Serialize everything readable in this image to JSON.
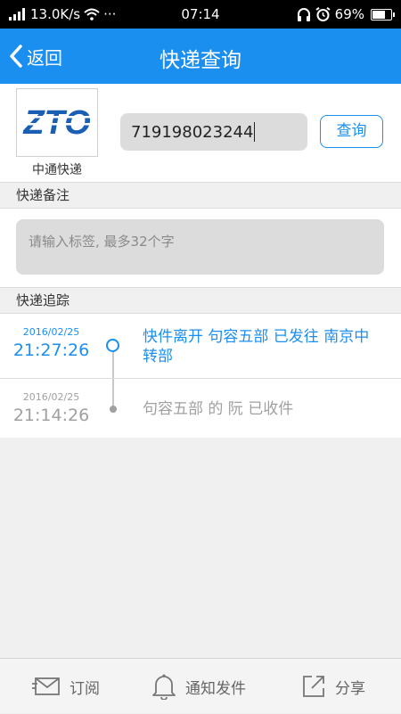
{
  "status_bar": {
    "network_speed": "13.0K/s",
    "more": "···",
    "time": "07:14",
    "battery_percent": "69%",
    "battery_level": 0.69
  },
  "nav": {
    "back_label": "返回",
    "title": "快递查询"
  },
  "carrier": {
    "logo_text": "ZTO",
    "name": "中通快递",
    "tracking_number": "719198023244",
    "query_label": "查询"
  },
  "remark": {
    "header": "快递备注",
    "placeholder": "请输入标签, 最多32个字"
  },
  "tracking": {
    "header": "快递追踪",
    "events": [
      {
        "date": "2016/02/25",
        "time": "21:27:26",
        "description": "快件离开 句容五部 已发往 南京中转部",
        "state": "latest"
      },
      {
        "date": "2016/02/25",
        "time": "21:14:26",
        "description": "句容五部 的 阮 已收件",
        "state": "past"
      }
    ]
  },
  "bottom_bar": {
    "subscribe_label": "订阅",
    "notify_label": "通知发件",
    "share_label": "分享"
  },
  "colors": {
    "accent": "#1b8ff0",
    "muted": "#a0a0a0",
    "background": "#f0f0f0"
  }
}
